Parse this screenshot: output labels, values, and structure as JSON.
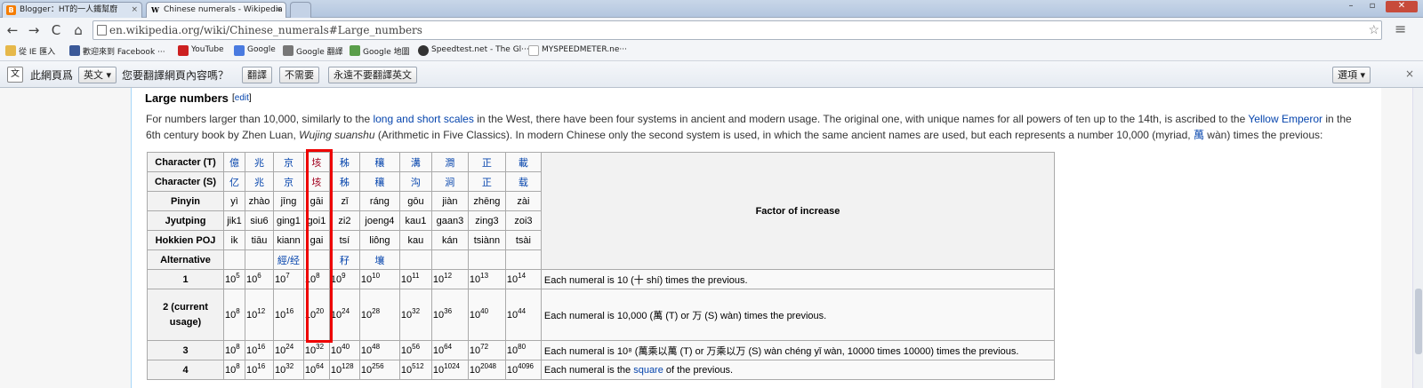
{
  "tabs": [
    {
      "label": "Blogger：HT的一人鐵幫廚",
      "favicon": "B",
      "close": "×"
    },
    {
      "label": "Chinese numerals - Wikipedia",
      "favicon": "W",
      "close": "×"
    }
  ],
  "window_controls": [
    "–",
    "▫",
    "✕"
  ],
  "nav": {
    "back": "←",
    "forward": "→",
    "reload": "C",
    "home": "⌂"
  },
  "url": "en.wikipedia.org/wiki/Chinese_numerals#Large_numbers",
  "star": "☆",
  "menu": "≡",
  "bookmarks": [
    {
      "label": "從 IE 匯入",
      "color": "#e6b84a"
    },
    {
      "label": "歡迎來到 Facebook ···",
      "color": "#3b5998"
    },
    {
      "label": "YouTube",
      "color": "#cc2020"
    },
    {
      "label": "Google",
      "color": "#4a7be0"
    },
    {
      "label": "Google 翻譯",
      "color": "#777"
    },
    {
      "label": "Google 地圖",
      "color": "#5a9e4a"
    },
    {
      "label": "Speedtest.net - The Gl···",
      "color": "#333"
    },
    {
      "label": "MYSPEEDMETER.ne···",
      "color": "#ccc"
    }
  ],
  "translate": {
    "page_is": "此網頁爲",
    "lang": "英文 ▾",
    "question": "您要翻譯網頁內容嗎？",
    "translate_btn": "翻譯",
    "no_btn": "不需要",
    "never_btn": "永遠不要翻譯英文",
    "options_btn": "選項 ▾",
    "close": "×"
  },
  "article": {
    "heading": "Large numbers",
    "edit": "edit",
    "para_1": "For numbers larger than 10,000, similarly to the ",
    "link_scales": "long and short scales",
    "para_2": " in the West, there have been four systems in ancient and modern usage. The original one, with unique names for all powers of ten up to the 14th, is ascribed to the ",
    "link_emperor": "Yellow Emperor",
    "para_3": " in the 6th century book by Zhen Luan, ",
    "book": "Wujing suanshu",
    "para_4": " (Arithmetic in Five Classics). In modern Chinese only the second system is used, in which the same ancient names are used, but each represents a number 10,000 (myriad, ",
    "link_wan": "萬",
    "para_5": " wàn) times the previous:"
  },
  "table": {
    "factor_header": "Factor of increase",
    "row_headers": [
      "Character (T)",
      "Character (S)",
      "Pinyin",
      "Jyutping",
      "Hokkien POJ",
      "Alternative"
    ],
    "char_t": [
      "億",
      "兆",
      "京",
      "垓",
      "秭",
      "穰",
      "溝",
      "澗",
      "正",
      "載"
    ],
    "char_s": [
      "亿",
      "兆",
      "京",
      "垓",
      "秭",
      "穰",
      "沟",
      "涧",
      "正",
      "载"
    ],
    "pinyin": [
      "yì",
      "zhào",
      "jīng",
      "gāi",
      "zǐ",
      "ráng",
      "gōu",
      "jiàn",
      "zhēng",
      "zài"
    ],
    "jyutping": [
      "jik1",
      "siu6",
      "ging1",
      "goi1",
      "zi2",
      "joeng4",
      "kau1",
      "gaan3",
      "zing3",
      "zoi3"
    ],
    "poj": [
      "ik",
      "tiāu",
      "kiann",
      "gai",
      "tsí",
      "liông",
      "kau",
      "kán",
      "tsiànn",
      "tsài"
    ],
    "alternative": [
      "",
      "",
      "經/经",
      "",
      "秄",
      "壤",
      "",
      "",
      "",
      ""
    ],
    "systems": [
      {
        "label": "1",
        "exponents": [
          "5",
          "6",
          "7",
          "8",
          "9",
          "10",
          "11",
          "12",
          "13",
          "14"
        ],
        "desc_1": "Each numeral is 10 (十 shí) times the previous.",
        "desc_link": "",
        "desc_2": ""
      },
      {
        "label": "2 (current usage)",
        "exponents": [
          "8",
          "12",
          "16",
          "20",
          "24",
          "28",
          "32",
          "36",
          "40",
          "44"
        ],
        "desc_1": "Each numeral is 10,000 (萬 (T) or 万 (S) wàn) times the previous.",
        "desc_link": "",
        "desc_2": ""
      },
      {
        "label": "3",
        "exponents": [
          "8",
          "16",
          "24",
          "32",
          "40",
          "48",
          "56",
          "64",
          "72",
          "80"
        ],
        "desc_1": "Each numeral is 10⁸ (萬乘以萬 (T) or 万乘以万 (S) wàn chéng yǐ wàn, 10000 times 10000) times the previous.",
        "desc_link": "",
        "desc_2": ""
      },
      {
        "label": "4",
        "exponents": [
          "8",
          "16",
          "32",
          "64",
          "128",
          "256",
          "512",
          "1024",
          "2048",
          "4096"
        ],
        "desc_1": "Each numeral is the ",
        "desc_link": "square",
        "desc_2": " of the previous."
      }
    ]
  },
  "highlight_color": "#e00000"
}
